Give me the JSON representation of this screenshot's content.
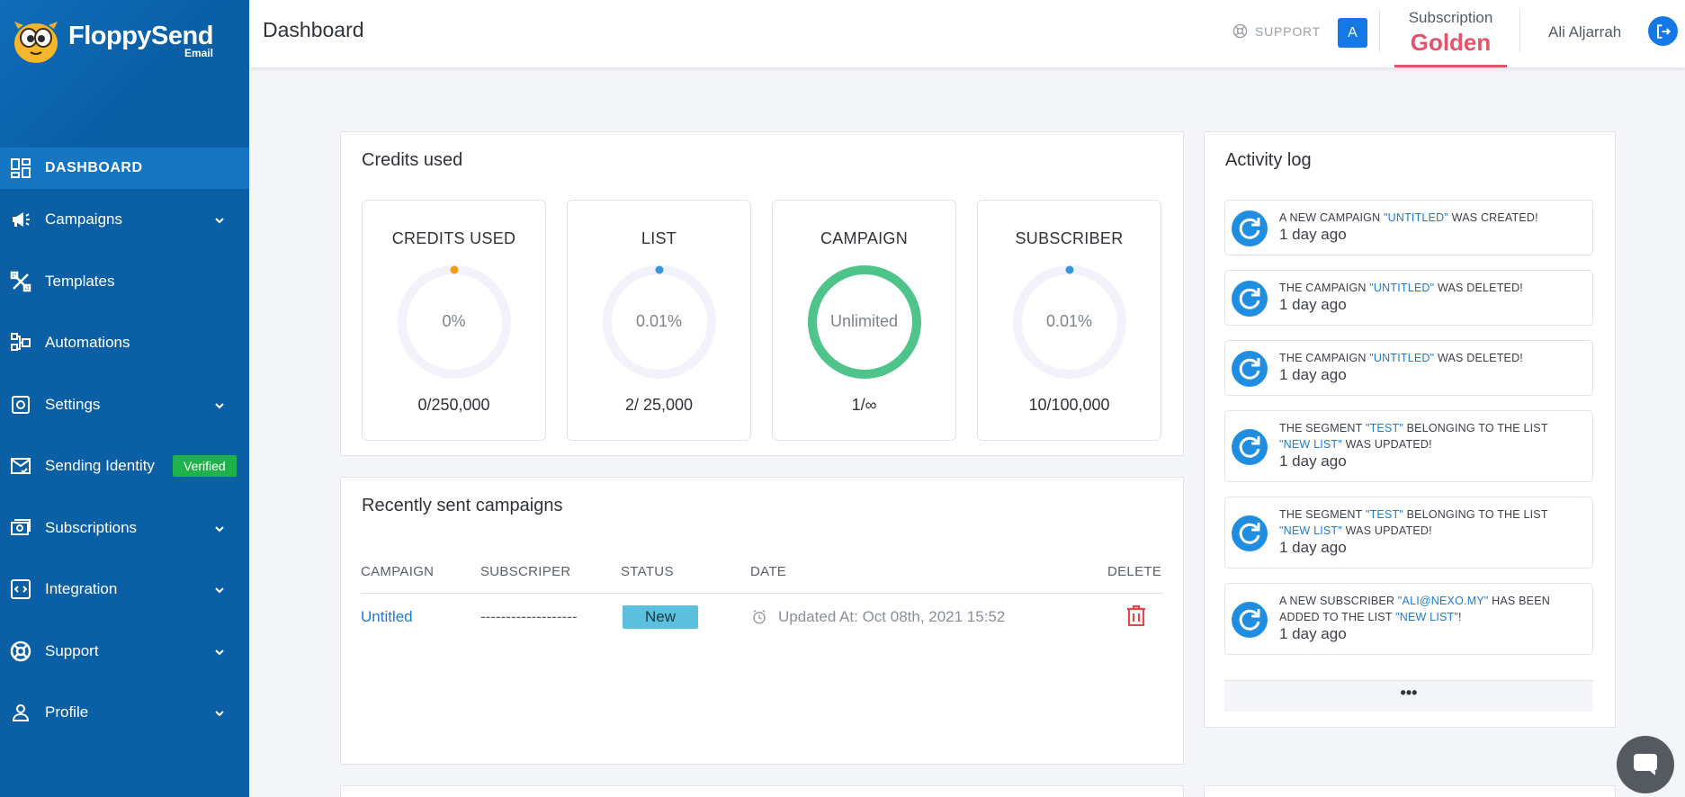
{
  "brand": {
    "name": "FloppySend",
    "sub": "Email"
  },
  "sidebar": {
    "items": [
      {
        "label": "DASHBOARD",
        "icon": "dashboard-icon"
      },
      {
        "label": "Campaigns",
        "icon": "megaphone-icon",
        "chevron": true
      },
      {
        "label": "Templates",
        "icon": "templates-icon"
      },
      {
        "label": "Automations",
        "icon": "automations-icon"
      },
      {
        "label": "Settings",
        "icon": "settings-icon",
        "chevron": true
      },
      {
        "label": "Sending Identity",
        "icon": "mail-check-icon",
        "badge": "Verified"
      },
      {
        "label": "Subscriptions",
        "icon": "subscriptions-icon",
        "chevron": true
      },
      {
        "label": "Integration",
        "icon": "integration-icon",
        "chevron": true
      },
      {
        "label": "Support",
        "icon": "lifebuoy-icon",
        "chevron": true
      },
      {
        "label": "Profile",
        "icon": "user-icon",
        "chevron": true
      }
    ]
  },
  "header": {
    "title": "Dashboard",
    "support_label": "SUPPORT",
    "avatar_letter": "A",
    "subscription_label": "Subscription",
    "subscription_value": "Golden",
    "username": "Ali Aljarrah"
  },
  "credits": {
    "title": "Credits used",
    "stats": [
      {
        "title": "CREDITS USED",
        "center": "0%",
        "footer": "0/250,000",
        "fraction": 0,
        "color": "#f39c12"
      },
      {
        "title": "LIST",
        "center": "0.01%",
        "footer": "2/ 25,000",
        "fraction": 0.0001,
        "color": "#3498db"
      },
      {
        "title": "CAMPAIGN",
        "center": "Unlimited",
        "footer": "1/∞",
        "fraction": 1,
        "color": "#4fc48a"
      },
      {
        "title": "SUBSCRIBER",
        "center": "0.01%",
        "footer": "10/100,000",
        "fraction": 0.0001,
        "color": "#3498db"
      }
    ]
  },
  "recent": {
    "title": "Recently sent campaigns",
    "columns": [
      "CAMPAIGN",
      "SUBSCRIPER",
      "STATUS",
      "DATE",
      "DELETE"
    ],
    "rows": [
      {
        "campaign": "Untitled",
        "subscriber": "-------------------",
        "status": "New",
        "date": "Updated At: Oct 08th, 2021 15:52"
      }
    ]
  },
  "activity": {
    "title": "Activity log",
    "items": [
      {
        "parts": [
          "A NEW CAMPAIGN ",
          "\"UNTITLED\"",
          " WAS CREATED!"
        ],
        "time": "1 day ago"
      },
      {
        "parts": [
          "THE CAMPAIGN ",
          "\"UNTITLED\"",
          " WAS DELETED!"
        ],
        "time": "1 day ago"
      },
      {
        "parts": [
          "THE CAMPAIGN ",
          "\"UNTITLED\"",
          " WAS DELETED!"
        ],
        "time": "1 day ago"
      },
      {
        "parts": [
          "THE SEGMENT ",
          "\"TEST\"",
          " BELONGING TO THE LIST ",
          "\"NEW LIST\"",
          " WAS UPDATED!"
        ],
        "time": "1 day ago"
      },
      {
        "parts": [
          "THE SEGMENT ",
          "\"TEST\"",
          " BELONGING TO THE LIST ",
          "\"NEW LIST\"",
          " WAS UPDATED!"
        ],
        "time": "1 day ago"
      },
      {
        "parts": [
          "A NEW SUBSCRIBER ",
          "\"ALI@NEXO.MY\"",
          " HAS BEEN ADDED TO THE LIST ",
          "\"NEW LIST\"",
          "!"
        ],
        "time": "1 day ago"
      }
    ],
    "more_label": "•••"
  }
}
